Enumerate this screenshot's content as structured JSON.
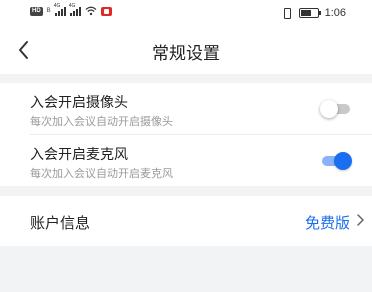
{
  "status_bar": {
    "left_hd": "HD",
    "left_b": "B",
    "sig1_tag": "4G",
    "sig2_tag": "4G",
    "time": "1:06",
    "icons": [
      "hd-icon",
      "signal-icon",
      "signal-icon",
      "wifi-icon",
      "screen-record-icon",
      "vibrate-icon",
      "battery-icon"
    ]
  },
  "nav": {
    "title": "常规设置",
    "back_icon": "chevron-left-icon"
  },
  "settings": {
    "camera": {
      "title": "入会开启摄像头",
      "subtitle": "每次加入会议自动开启摄像头",
      "enabled": false
    },
    "microphone": {
      "title": "入会开启麦克风",
      "subtitle": "每次加入会议自动开启麦克风",
      "enabled": true
    }
  },
  "account": {
    "label": "账户信息",
    "value": "免费版",
    "chevron_icon": "chevron-right-icon"
  },
  "colors": {
    "accent": "#1a6ef0",
    "background": "#f2f3f5",
    "record_red": "#e02828"
  }
}
